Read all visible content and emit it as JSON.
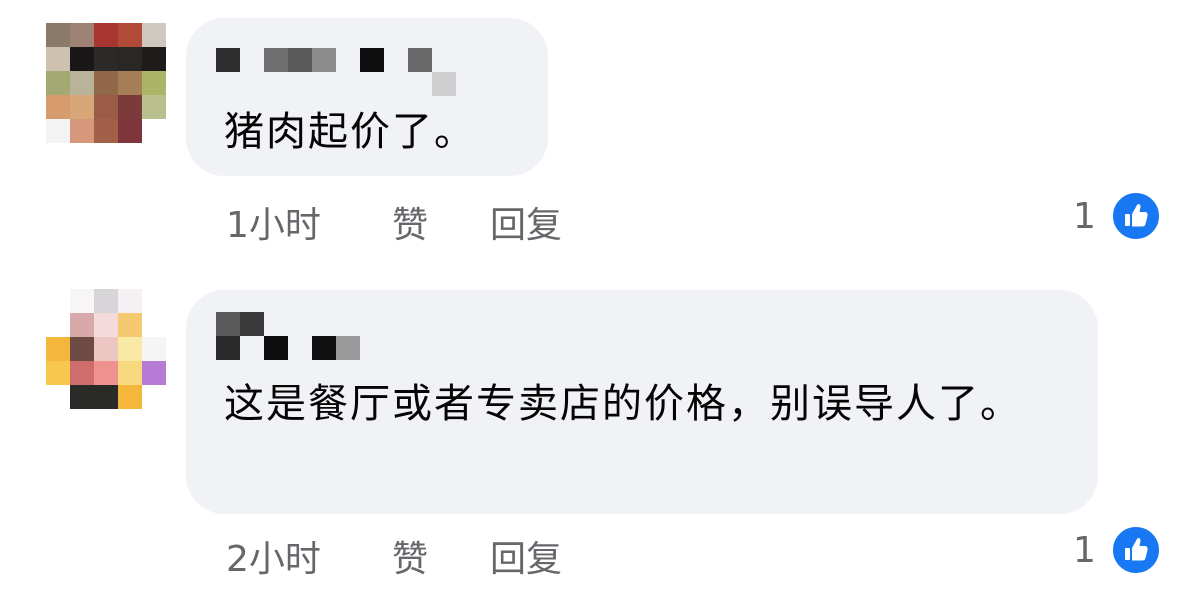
{
  "comments": [
    {
      "text": "猪肉起价了。",
      "time": "1小时",
      "like_label": "赞",
      "reply_label": "回复",
      "like_count": "1",
      "avatar_colors": [
        [
          "#8a7a68",
          "#9d8172",
          "#a83530",
          "#b04a39",
          "#cfc8bf"
        ],
        [
          "#cfc1b0",
          "#191717",
          "#2c2a28",
          "#2a2824",
          "#1e1c19"
        ],
        [
          "#a4a873",
          "#b9b39a",
          "#936849",
          "#a67e57",
          "#acb467"
        ],
        [
          "#d69c6d",
          "#d8a777",
          "#9a5b49",
          "#7b3b3a",
          "#b9c08e"
        ],
        [
          "#f3f3f3",
          "#d6977b",
          "#a36049",
          "#80343b",
          "#ffffff"
        ]
      ]
    },
    {
      "text": "这是餐厅或者专卖店的价格，别误导人了。",
      "time": "2小时",
      "like_label": "赞",
      "reply_label": "回复",
      "like_count": "1",
      "avatar_colors": [
        [
          "#ffffff",
          "#f7f5f6",
          "#d7d5d8",
          "#f4f0f4",
          "#ffffff"
        ],
        [
          "#ffffff",
          "#d7a9a9",
          "#f4dada",
          "#f5c872",
          "#ffffff"
        ],
        [
          "#f4b73c",
          "#6d4a44",
          "#ecc7c2",
          "#fae8a5",
          "#f5f5f5"
        ],
        [
          "#f7c74e",
          "#cf6d6c",
          "#ef918e",
          "#f7d97f",
          "#b57bd5"
        ],
        [
          "#ffffff",
          "#2a2a28",
          "#2a2a28",
          "#f4b73c",
          "#ffffff"
        ]
      ]
    }
  ],
  "colors": {
    "bubble": "#f0f2f5",
    "meta_text": "#65676b",
    "like_blue": "#1877f2"
  },
  "icons": {
    "like": "thumbs-up-icon"
  }
}
